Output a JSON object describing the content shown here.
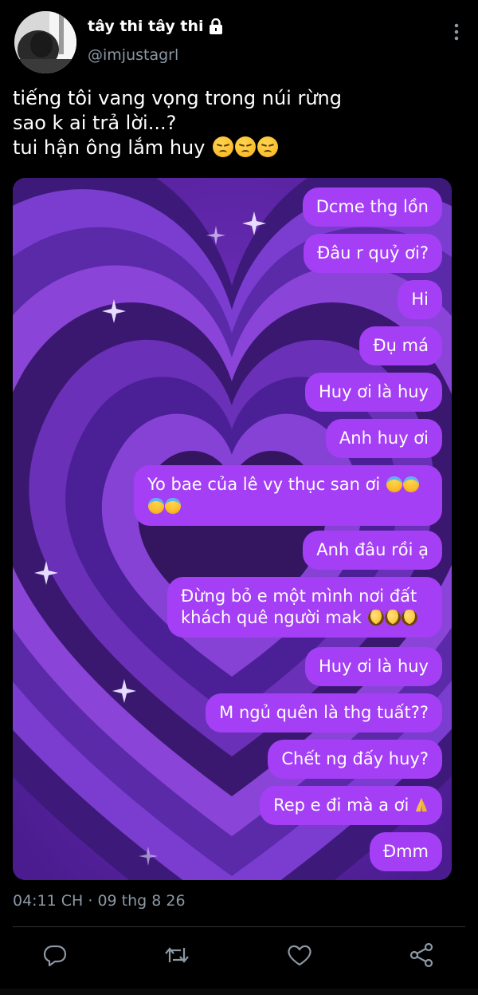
{
  "profile": {
    "display_name": "tây thi tây thi",
    "handle": "@imjustagrl"
  },
  "tweet": {
    "lines": [
      "tiếng tôi vang vọng trong núi rừng",
      "sao k ai trả lời...?",
      "tui hận ông lắm huy"
    ],
    "timestamp": "04:11 CH · 09 thg 8 26"
  },
  "chat": {
    "messages": [
      {
        "text": "Dcme thg lồn"
      },
      {
        "text": "Đâu r quỷ ơi?"
      },
      {
        "text": "Hi"
      },
      {
        "text": "Đụ má"
      },
      {
        "text": "Huy ơi là huy"
      },
      {
        "text": "Anh huy ơi"
      },
      {
        "text": "Yo bae của lê vy thục san ơi"
      },
      {
        "text": "Anh đâu rồi ạ"
      },
      {
        "text": "Đừng bỏ e một mình nơi đất"
      },
      {
        "text": "khách quê người mak"
      },
      {
        "text": "Huy ơi là huy"
      },
      {
        "text": "M ngủ quên là thg tuất??"
      },
      {
        "text": "Chết ng đấy huy?"
      },
      {
        "text": "Rep e đi mà a ơi"
      },
      {
        "text": "Đmm"
      }
    ]
  },
  "icons": {
    "lock": "lock-icon",
    "more": "more-vertical-icon",
    "reply": "reply-icon",
    "retweet": "retweet-icon",
    "like": "heart-icon",
    "share": "share-icon"
  },
  "colors": {
    "background": "#000000",
    "bubble": "#a43ff5",
    "media_base": "#6a2ab8",
    "secondary_text": "#8b98a5"
  }
}
